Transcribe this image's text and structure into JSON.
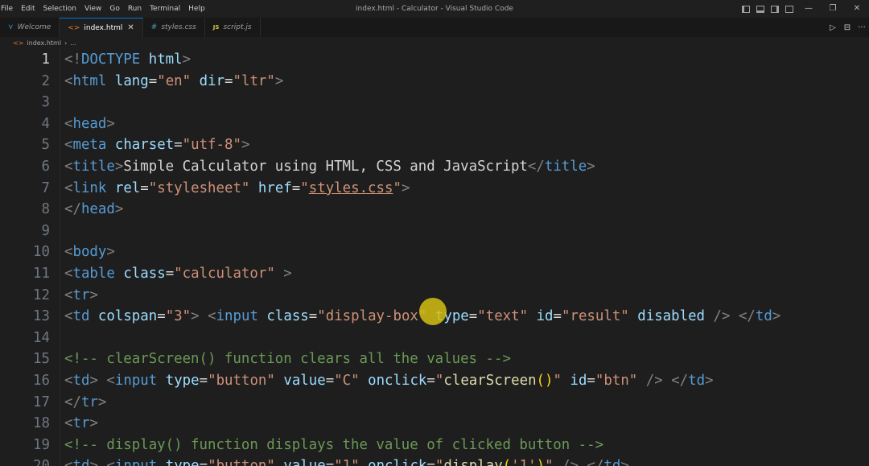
{
  "menu": [
    "File",
    "Edit",
    "Selection",
    "View",
    "Go",
    "Run",
    "Terminal",
    "Help"
  ],
  "window_title": "index.html - Calculator - Visual Studio Code",
  "tabs": [
    {
      "label": "Welcome",
      "icon": "vscode-icon",
      "active": false
    },
    {
      "label": "index.html",
      "icon": "html-icon",
      "active": true
    },
    {
      "label": "styles.css",
      "icon": "css-icon",
      "active": false
    },
    {
      "label": "script.js",
      "icon": "js-icon",
      "active": false
    }
  ],
  "tab_glyphs": {
    "welcome": "⋎",
    "html": "<>",
    "css": "#",
    "js": "JS",
    "close": "✕"
  },
  "breadcrumb": {
    "file": "index.html",
    "more": "..."
  },
  "title_actions": {
    "minimize": "—",
    "maximize": "❐",
    "close": "✕"
  },
  "tab_actions": {
    "run": "▷",
    "split": "⊟",
    "more": "···"
  },
  "colors": {
    "accent": "#0078d4",
    "background": "#1e1e1e",
    "cursor_highlight": "#d4be14"
  },
  "lines": [
    {
      "n": "1",
      "tokens": [
        [
          "t-tag",
          "<!"
        ],
        [
          "t-name",
          "DOCTYPE"
        ],
        [
          "t-text",
          " "
        ],
        [
          "t-attr",
          "html"
        ],
        [
          "t-tag",
          ">"
        ]
      ]
    },
    {
      "n": "2",
      "tokens": [
        [
          "t-tag",
          "<"
        ],
        [
          "t-name",
          "html"
        ],
        [
          "t-text",
          " "
        ],
        [
          "t-attr",
          "lang"
        ],
        [
          "t-punc",
          "="
        ],
        [
          "t-str",
          "\"en\""
        ],
        [
          "t-text",
          " "
        ],
        [
          "t-attr",
          "dir"
        ],
        [
          "t-punc",
          "="
        ],
        [
          "t-str",
          "\"ltr\""
        ],
        [
          "t-tag",
          ">"
        ]
      ]
    },
    {
      "n": "3",
      "tokens": []
    },
    {
      "n": "4",
      "tokens": [
        [
          "t-tag",
          "<"
        ],
        [
          "t-name",
          "head"
        ],
        [
          "t-tag",
          ">"
        ]
      ]
    },
    {
      "n": "5",
      "tokens": [
        [
          "t-tag",
          "<"
        ],
        [
          "t-name",
          "meta"
        ],
        [
          "t-text",
          " "
        ],
        [
          "t-attr",
          "charset"
        ],
        [
          "t-punc",
          "="
        ],
        [
          "t-str",
          "\"utf-8\""
        ],
        [
          "t-tag",
          ">"
        ]
      ]
    },
    {
      "n": "6",
      "tokens": [
        [
          "t-tag",
          "<"
        ],
        [
          "t-name",
          "title"
        ],
        [
          "t-tag",
          ">"
        ],
        [
          "t-text",
          "Simple Calculator using HTML, CSS and JavaScript"
        ],
        [
          "t-tag",
          "</"
        ],
        [
          "t-name",
          "title"
        ],
        [
          "t-tag",
          ">"
        ]
      ]
    },
    {
      "n": "7",
      "tokens": [
        [
          "t-tag",
          "<"
        ],
        [
          "t-name",
          "link"
        ],
        [
          "t-text",
          " "
        ],
        [
          "t-attr",
          "rel"
        ],
        [
          "t-punc",
          "="
        ],
        [
          "t-str",
          "\"stylesheet\""
        ],
        [
          "t-text",
          " "
        ],
        [
          "t-attr",
          "href"
        ],
        [
          "t-punc",
          "="
        ],
        [
          "t-str",
          "\""
        ],
        [
          "t-link",
          "styles.css"
        ],
        [
          "t-str",
          "\""
        ],
        [
          "t-tag",
          ">"
        ]
      ]
    },
    {
      "n": "8",
      "tokens": [
        [
          "t-tag",
          "</"
        ],
        [
          "t-name",
          "head"
        ],
        [
          "t-tag",
          ">"
        ]
      ]
    },
    {
      "n": "9",
      "tokens": []
    },
    {
      "n": "10",
      "tokens": [
        [
          "t-tag",
          "<"
        ],
        [
          "t-name",
          "body"
        ],
        [
          "t-tag",
          ">"
        ]
      ]
    },
    {
      "n": "11",
      "tokens": [
        [
          "t-tag",
          "<"
        ],
        [
          "t-name",
          "table"
        ],
        [
          "t-text",
          " "
        ],
        [
          "t-attr",
          "class"
        ],
        [
          "t-punc",
          "="
        ],
        [
          "t-str",
          "\"calculator\""
        ],
        [
          "t-text",
          " "
        ],
        [
          "t-tag",
          ">"
        ]
      ]
    },
    {
      "n": "12",
      "tokens": [
        [
          "t-tag",
          "<"
        ],
        [
          "t-name",
          "tr"
        ],
        [
          "t-tag",
          ">"
        ]
      ]
    },
    {
      "n": "13",
      "tokens": [
        [
          "t-tag",
          "<"
        ],
        [
          "t-name",
          "td"
        ],
        [
          "t-text",
          " "
        ],
        [
          "t-attr",
          "colspan"
        ],
        [
          "t-punc",
          "="
        ],
        [
          "t-str",
          "\"3\""
        ],
        [
          "t-tag",
          ">"
        ],
        [
          "t-text",
          " "
        ],
        [
          "t-tag",
          "<"
        ],
        [
          "t-name",
          "input"
        ],
        [
          "t-text",
          " "
        ],
        [
          "t-attr",
          "class"
        ],
        [
          "t-punc",
          "="
        ],
        [
          "t-str",
          "\"display-box\""
        ],
        [
          "t-text",
          " "
        ],
        [
          "t-attr",
          "type"
        ],
        [
          "t-punc",
          "="
        ],
        [
          "t-str",
          "\"text\""
        ],
        [
          "t-text",
          " "
        ],
        [
          "t-attr",
          "id"
        ],
        [
          "t-punc",
          "="
        ],
        [
          "t-str",
          "\"result\""
        ],
        [
          "t-text",
          " "
        ],
        [
          "t-attr",
          "disabled"
        ],
        [
          "t-text",
          " "
        ],
        [
          "t-tag",
          "/>"
        ],
        [
          "t-text",
          " "
        ],
        [
          "t-tag",
          "</"
        ],
        [
          "t-name",
          "td"
        ],
        [
          "t-tag",
          ">"
        ]
      ]
    },
    {
      "n": "14",
      "tokens": []
    },
    {
      "n": "15",
      "tokens": [
        [
          "t-cmt",
          "<!-- clearScreen() function clears all the values -->"
        ]
      ]
    },
    {
      "n": "16",
      "tokens": [
        [
          "t-tag",
          "<"
        ],
        [
          "t-name",
          "td"
        ],
        [
          "t-tag",
          ">"
        ],
        [
          "t-text",
          " "
        ],
        [
          "t-tag",
          "<"
        ],
        [
          "t-name",
          "input"
        ],
        [
          "t-text",
          " "
        ],
        [
          "t-attr",
          "type"
        ],
        [
          "t-punc",
          "="
        ],
        [
          "t-str",
          "\"button\""
        ],
        [
          "t-text",
          " "
        ],
        [
          "t-attr",
          "value"
        ],
        [
          "t-punc",
          "="
        ],
        [
          "t-str",
          "\"C\""
        ],
        [
          "t-text",
          " "
        ],
        [
          "t-attr",
          "onclick"
        ],
        [
          "t-punc",
          "="
        ],
        [
          "t-str",
          "\""
        ],
        [
          "t-fn",
          "clearScreen"
        ],
        [
          "t-paren",
          "()"
        ],
        [
          "t-str",
          "\""
        ],
        [
          "t-text",
          " "
        ],
        [
          "t-attr",
          "id"
        ],
        [
          "t-punc",
          "="
        ],
        [
          "t-str",
          "\"btn\""
        ],
        [
          "t-text",
          " "
        ],
        [
          "t-tag",
          "/>"
        ],
        [
          "t-text",
          " "
        ],
        [
          "t-tag",
          "</"
        ],
        [
          "t-name",
          "td"
        ],
        [
          "t-tag",
          ">"
        ]
      ]
    },
    {
      "n": "17",
      "tokens": [
        [
          "t-tag",
          "</"
        ],
        [
          "t-name",
          "tr"
        ],
        [
          "t-tag",
          ">"
        ]
      ]
    },
    {
      "n": "18",
      "tokens": [
        [
          "t-tag",
          "<"
        ],
        [
          "t-name",
          "tr"
        ],
        [
          "t-tag",
          ">"
        ]
      ]
    },
    {
      "n": "19",
      "tokens": [
        [
          "t-cmt",
          "<!-- display() function displays the value of clicked button -->"
        ]
      ]
    },
    {
      "n": "20",
      "tokens": [
        [
          "t-tag",
          "<"
        ],
        [
          "t-name",
          "td"
        ],
        [
          "t-tag",
          ">"
        ],
        [
          "t-text",
          " "
        ],
        [
          "t-tag",
          "<"
        ],
        [
          "t-name",
          "input"
        ],
        [
          "t-text",
          " "
        ],
        [
          "t-attr",
          "type"
        ],
        [
          "t-punc",
          "="
        ],
        [
          "t-str",
          "\"button\""
        ],
        [
          "t-text",
          " "
        ],
        [
          "t-attr",
          "value"
        ],
        [
          "t-punc",
          "="
        ],
        [
          "t-str",
          "\"1\""
        ],
        [
          "t-text",
          " "
        ],
        [
          "t-attr",
          "onclick"
        ],
        [
          "t-punc",
          "="
        ],
        [
          "t-str",
          "\""
        ],
        [
          "t-fn",
          "display"
        ],
        [
          "t-paren",
          "("
        ],
        [
          "t-str",
          "'1'"
        ],
        [
          "t-paren",
          ")"
        ],
        [
          "t-str",
          "\""
        ],
        [
          "t-text",
          " "
        ],
        [
          "t-tag",
          "/>"
        ],
        [
          "t-text",
          " "
        ],
        [
          "t-tag",
          "</"
        ],
        [
          "t-name",
          "td"
        ],
        [
          "t-tag",
          ">"
        ]
      ]
    }
  ],
  "current_line": "1"
}
